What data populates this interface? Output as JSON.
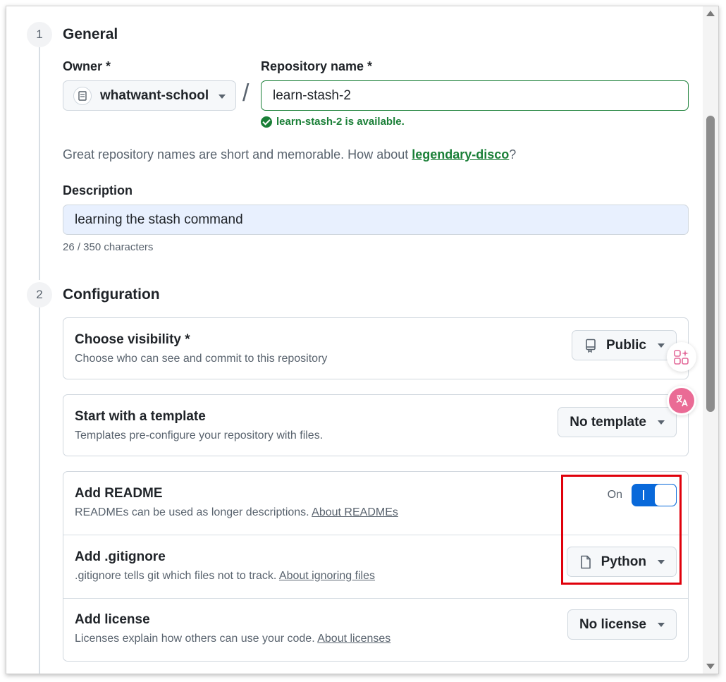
{
  "steps": [
    {
      "number": "1",
      "title": "General"
    },
    {
      "number": "2",
      "title": "Configuration"
    }
  ],
  "general": {
    "owner_label": "Owner *",
    "owner_value": "whatwant-school",
    "slash": "/",
    "repo_label": "Repository name *",
    "repo_value": "learn-stash-2",
    "availability": "learn-stash-2 is available.",
    "suggestion_prefix": "Great repository names are short and memorable. How about ",
    "suggestion_name": "legendary-disco",
    "suggestion_suffix": "?",
    "description_label": "Description",
    "description_value": "learning the stash command",
    "char_count": "26 / 350 characters"
  },
  "configuration": {
    "visibility": {
      "title": "Choose visibility *",
      "subtitle": "Choose who can see and commit to this repository",
      "button": "Public",
      "icon": "repo-icon"
    },
    "template": {
      "title": "Start with a template",
      "subtitle": "Templates pre-configure your repository with files.",
      "button": "No template"
    },
    "readme": {
      "title": "Add README",
      "subtitle": "READMEs can be used as longer descriptions.",
      "link": "About READMEs",
      "toggle_label": "On",
      "toggle_on": true
    },
    "gitignore": {
      "title": "Add .gitignore",
      "subtitle": ".gitignore tells git which files not to track.",
      "link": "About ignoring files",
      "button": "Python",
      "icon": "file-icon"
    },
    "license": {
      "title": "Add license",
      "subtitle": "Licenses explain how others can use your code.",
      "link": "About licenses",
      "button": "No license"
    }
  },
  "colors": {
    "success": "#1a7f37",
    "accent": "#0969da",
    "highlight": "#e0000b"
  }
}
